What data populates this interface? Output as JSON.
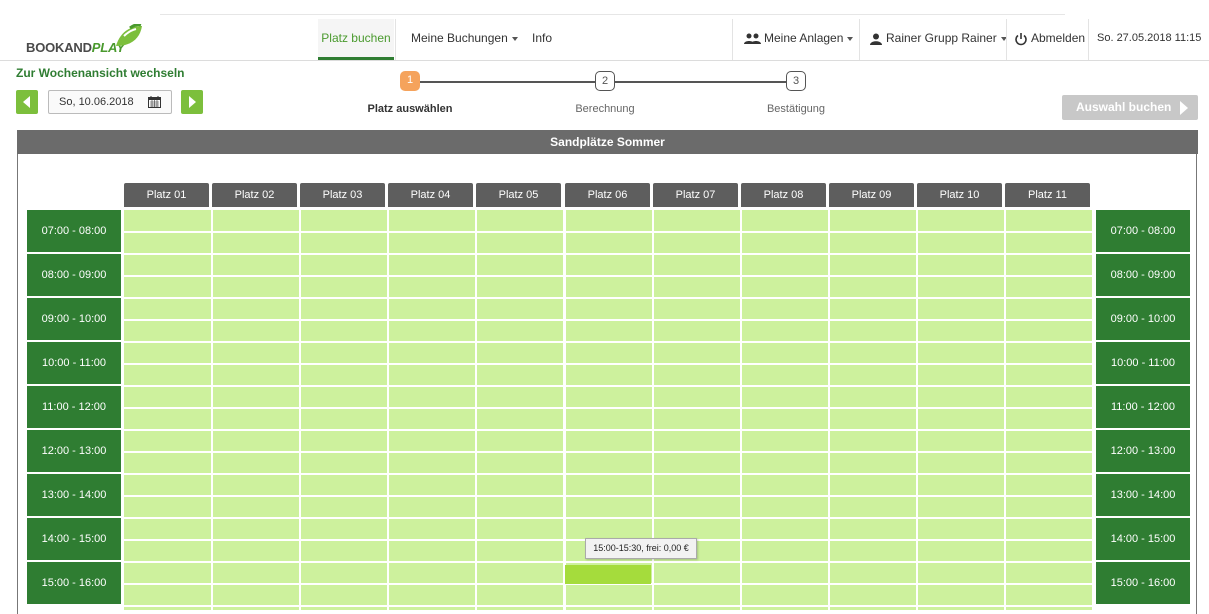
{
  "brand": {
    "text_left": "BOOKAND",
    "text_right": "PLAY"
  },
  "nav": {
    "book_court": "Platz buchen",
    "my_bookings": "Meine Buchungen",
    "info": "Info",
    "my_facilities": "Meine Anlagen",
    "user": "Rainer Grupp Rainer",
    "logout": "Abmelden",
    "datetime": "So. 27.05.2018 11:15"
  },
  "toolbar": {
    "week_view_link": "Zur Wochenansicht wechseln",
    "date": "So, 10.06.2018",
    "book_button": "Auswahl buchen"
  },
  "steps": [
    {
      "number": "1",
      "label": "Platz auswählen",
      "active": true
    },
    {
      "number": "2",
      "label": "Berechnung",
      "active": false
    },
    {
      "number": "3",
      "label": "Bestätigung",
      "active": false
    }
  ],
  "panel": {
    "title": "Sandplätze Sommer"
  },
  "courts": [
    "Platz 01",
    "Platz 02",
    "Platz 03",
    "Platz 04",
    "Platz 05",
    "Platz 06",
    "Platz 07",
    "Platz 08",
    "Platz 09",
    "Platz 10",
    "Platz 11"
  ],
  "time_slots": [
    "07:00 - 08:00",
    "08:00 - 09:00",
    "09:00 - 10:00",
    "10:00 - 11:00",
    "11:00 - 12:00",
    "12:00 - 13:00",
    "13:00 - 14:00",
    "14:00 - 15:00",
    "15:00 - 16:00"
  ],
  "selection": {
    "court_index": 5,
    "time": "15:00-15:30",
    "tooltip": "15:00-15:30, frei: 0,00 €"
  },
  "colors": {
    "free_slot": "#cdf19d",
    "selected_slot": "#a5dc3c",
    "time_label_bg": "#2f7d32",
    "active_step": "#f5a35c",
    "accent": "#4a9a2e"
  }
}
